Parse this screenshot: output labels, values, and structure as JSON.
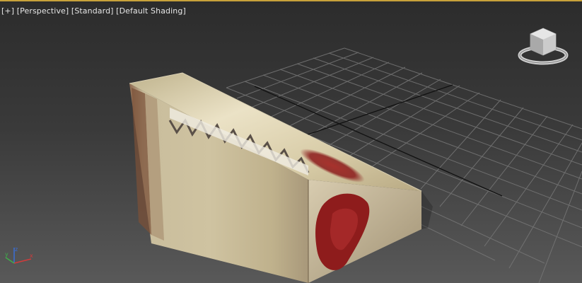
{
  "viewport": {
    "menu_plus": "[+]",
    "view_mode": "[Perspective]",
    "shading_style": "[Standard]",
    "shading_mode": "[Default Shading]"
  },
  "viewcube": {
    "icon": "viewcube-icon",
    "compass_icon": "compass-ring-icon"
  },
  "axis_tripod": {
    "icon": "axis-tripod-icon",
    "x_color": "#d23b3b",
    "y_color": "#3fae4a",
    "z_color": "#3a6ed8"
  },
  "colors": {
    "active_border": "#c8a23a",
    "grid_line": "#7a7a7a",
    "grid_axis": "#111111"
  }
}
